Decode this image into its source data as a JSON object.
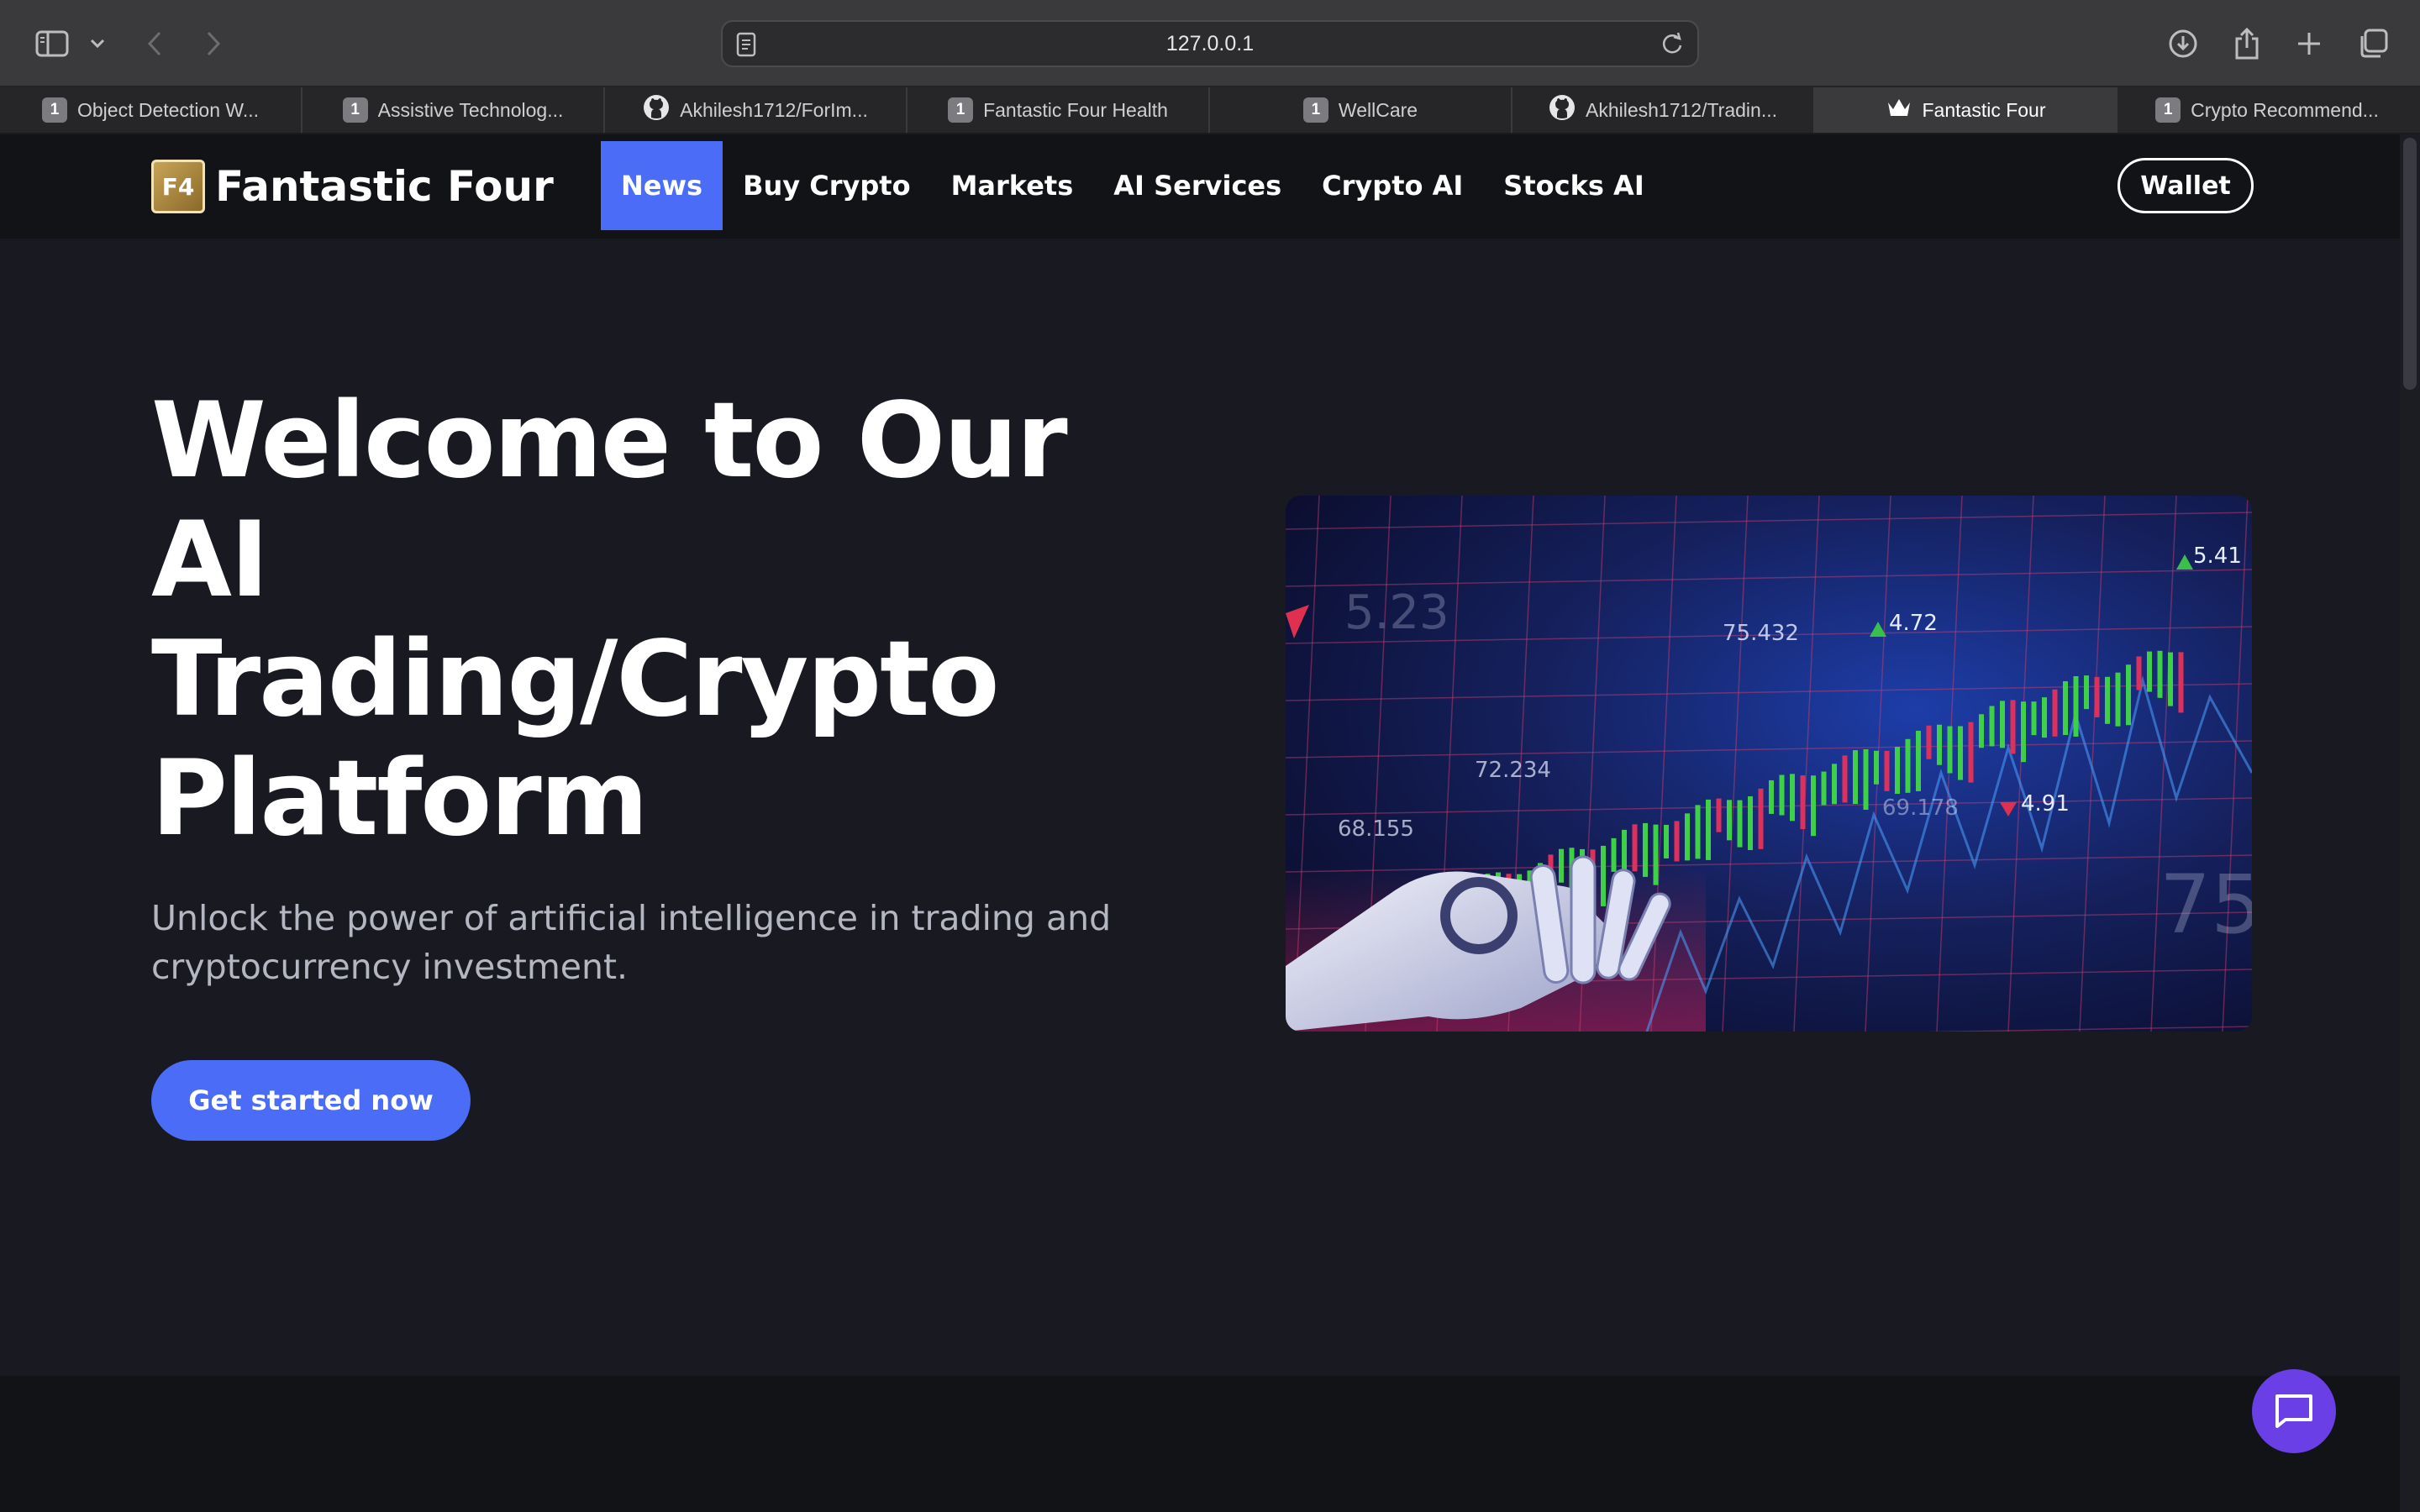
{
  "browser": {
    "url": "127.0.0.1",
    "tabs": [
      {
        "label": "Object Detection W...",
        "icon": "badge-1"
      },
      {
        "label": "Assistive Technolog...",
        "icon": "badge-1"
      },
      {
        "label": "Akhilesh1712/ForIm...",
        "icon": "github-icon"
      },
      {
        "label": "Fantastic Four Health",
        "icon": "badge-1"
      },
      {
        "label": "WellCare",
        "icon": "badge-1"
      },
      {
        "label": "Akhilesh1712/Tradin...",
        "icon": "github-icon"
      },
      {
        "label": "Fantastic Four",
        "icon": "crown-icon",
        "active": true
      },
      {
        "label": "Crypto Recommend...",
        "icon": "badge-1"
      }
    ],
    "badge_text": "1"
  },
  "site": {
    "logo_mark": "F4",
    "brand": "Fantastic Four",
    "menu": [
      {
        "label": "News",
        "active": true
      },
      {
        "label": "Buy Crypto"
      },
      {
        "label": "Markets"
      },
      {
        "label": "AI Services"
      },
      {
        "label": "Crypto AI"
      },
      {
        "label": "Stocks AI"
      }
    ],
    "wallet_label": "Wallet",
    "accent_color": "#4a6cf7",
    "chat_color": "#6b3fe6"
  },
  "hero": {
    "title_line1": "Welcome to Our",
    "title_line2": "AI",
    "title_line3": "Trading/Crypto",
    "title_line4": "Platform",
    "subtitle": "Unlock the power of artificial intelligence in trading and cryptocurrency investment.",
    "cta_label": "Get started now",
    "image_labels": [
      "5.41",
      "4.72",
      "75.432",
      "5.23",
      "72.234",
      "68.155",
      "69.178",
      "4.91",
      "75"
    ]
  }
}
